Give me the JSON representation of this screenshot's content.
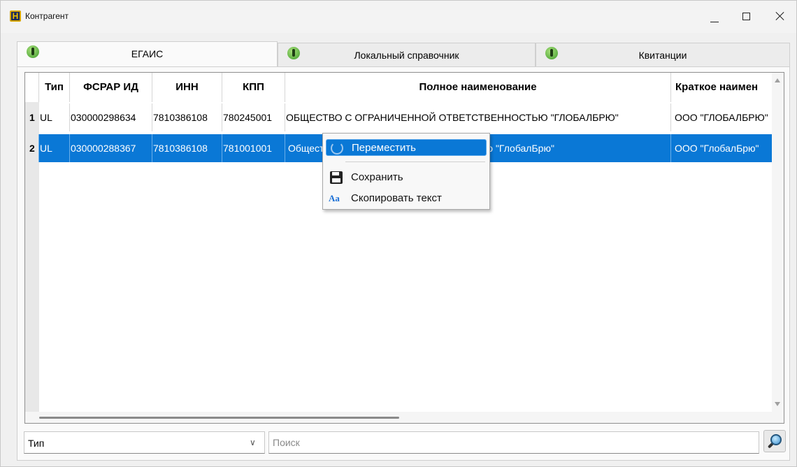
{
  "window": {
    "title": "Контрагент",
    "app_icon_letter": "H"
  },
  "tabs": [
    {
      "label": "ЕГАИС",
      "active": true
    },
    {
      "label": "Локальный справочник",
      "active": false
    },
    {
      "label": "Квитанции",
      "active": false
    }
  ],
  "table": {
    "columns": [
      "Тип",
      "ФСРАР ИД",
      "ИНН",
      "КПП",
      "Полное наименование",
      "Краткое наимен"
    ],
    "rows": [
      {
        "num": "1",
        "type": "UL",
        "fsrar": "030000298634",
        "inn": "7810386108",
        "kpp": "780245001",
        "full": "ОБЩЕСТВО С ОГРАНИЧЕННОЙ ОТВЕТСТВЕННОСТЬЮ \"ГЛОБАЛБРЮ\"",
        "short": "ООО \"ГЛОБАЛБРЮ\"",
        "selected": false
      },
      {
        "num": "2",
        "type": "UL",
        "fsrar": "030000288367",
        "inn": "7810386108",
        "kpp": "781001001",
        "full": "Общество с ограниченной ответственностью \"ГлобалБрю\"",
        "short": "ООО \"ГлобалБрю\"",
        "selected": true
      }
    ]
  },
  "context_menu": {
    "items": [
      {
        "label": "Переместить",
        "icon": "move-icon",
        "highlighted": true
      },
      {
        "label": "Сохранить",
        "icon": "save-icon",
        "highlighted": false
      },
      {
        "label": "Скопировать текст",
        "icon": "copy-text-icon",
        "highlighted": false
      }
    ],
    "copy_icon_glyph": "Aa"
  },
  "filter": {
    "type_select_value": "Тип",
    "search_placeholder": "Поиск"
  },
  "colors": {
    "selection": "#0a78d6",
    "tab_icon": "#3f9c2d"
  }
}
